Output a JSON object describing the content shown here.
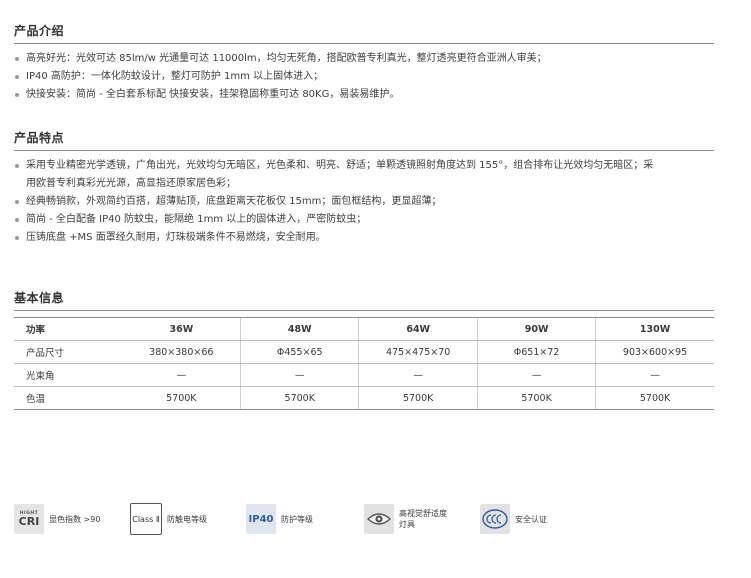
{
  "intro": {
    "title": "产品介绍",
    "items": [
      "高亮好光：光效可达 85lm/w 光通量可达 11000lm，均匀无死角，搭配欧普专利真光，整灯透亮更符合亚洲人审美；",
      "IP40 高防护：一体化防蚊设计，整灯可防护 1mm 以上固体进入；",
      "快接安装：简尚 - 全白套系标配 快接安装，挂架稳固称重可达 80KG，易装易维护。"
    ]
  },
  "features": {
    "title": "产品特点",
    "items": [
      "采用专业精密光学透镜，广角出光，光效均匀无暗区，光色柔和、明亮、舒适；单颗透镜照射角度达到 155°，组合排布让光效均匀无暗区；采",
      "用欧普专利真彩光光源，高显指还原家居色彩；",
      "经典畅销款，外观简约百搭，超薄贴顶，底盘距离天花板仅 15mm；面包框结构，更显超薄；",
      "简尚 - 全白配备 IP40 防蚊虫，能隔绝 1mm 以上的固体进入，严密防蚊虫；",
      "压铸底盘 +MS 面罩经久耐用，灯珠极端条件不易燃烧，安全耐用。"
    ]
  },
  "basic": {
    "title": "基本信息",
    "table": {
      "header": [
        "功率",
        "36W",
        "48W",
        "64W",
        "90W",
        "130W"
      ],
      "rows": [
        [
          "产品尺寸",
          "380×380×66",
          "Φ455×65",
          "475×475×70",
          "Φ651×72",
          "903×600×95"
        ],
        [
          "光束角",
          "—",
          "—",
          "—",
          "—",
          "—"
        ],
        [
          "色温",
          "5700K",
          "5700K",
          "5700K",
          "5700K",
          "5700K"
        ]
      ]
    }
  },
  "badges": [
    {
      "icon": "cri-icon",
      "icon_small": "HIGHT",
      "icon_big": "CRI",
      "label": "显色指数 >90"
    },
    {
      "icon": "class-ii-icon",
      "icon_text": "Class Ⅱ",
      "label": "防触电等级"
    },
    {
      "icon": "ip40-icon",
      "icon_text": "IP40",
      "label": "防护等级"
    },
    {
      "icon": "eye-comfort-icon",
      "label_line1": "高视觉舒适度",
      "label_line2": "灯具"
    },
    {
      "icon": "ccc-icon",
      "label": "安全认证"
    }
  ]
}
